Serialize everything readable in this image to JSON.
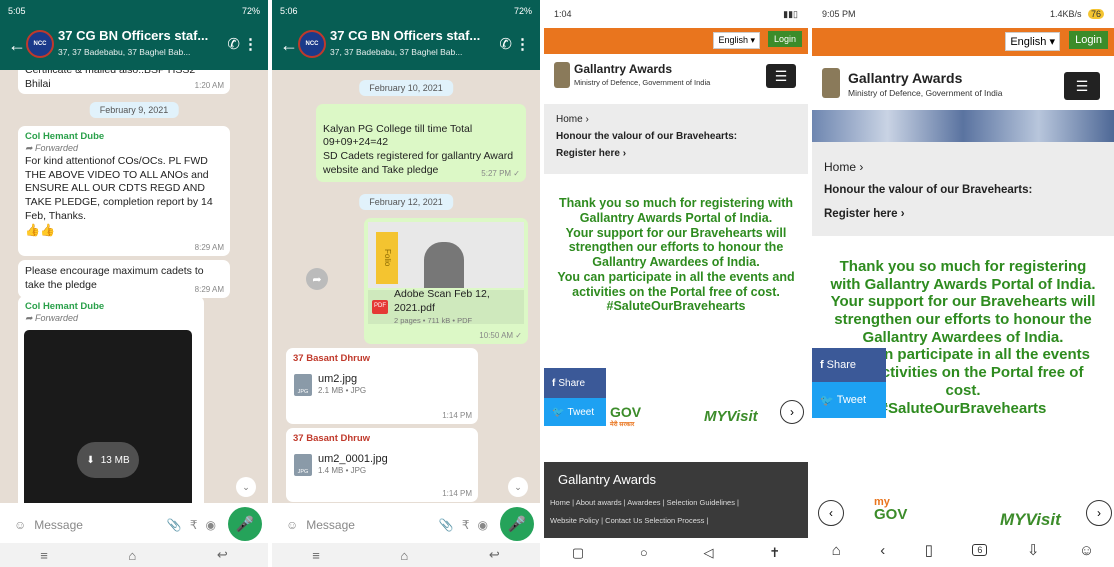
{
  "wa1": {
    "status_time": "5:05",
    "status_battery": "72%",
    "title": "37 CG BN Officers staf...",
    "subtitle": "37, 37 Badebabu, 37 Baghel Bab...",
    "top_text": "Certificate & mailed also..BSP HSS2 Bhilai",
    "top_time": "1:20 AM",
    "date": "February 9, 2021",
    "msg1": {
      "sender": "Col Hemant Dube",
      "fwd": "Forwarded",
      "text": "For kind attentionof COs/OCs.  PL FWD THE ABOVE VIDEO TO ALL ANOs and  ENSURE ALL OUR CDTS REGD AND TAKE PLEDGE, completion report by 14 Feb, Thanks.",
      "emoji": "👍👍",
      "time": "8:29 AM"
    },
    "msg2": {
      "text": "Please encourage maximum cadets to take the pledge",
      "time": "8:29 AM"
    },
    "msg3": {
      "sender": "Col Hemant Dube",
      "fwd": "Forwarded",
      "video_size": "13 MB"
    },
    "input_placeholder": "Message"
  },
  "wa2": {
    "status_time": "5:06",
    "status_battery": "72%",
    "title": "37 CG BN Officers staf...",
    "subtitle": "37, 37 Badebabu, 37 Baghel Bab...",
    "date1": "February 10, 2021",
    "out1": {
      "text": "Kalyan PG College till time Total\n 09+09+24=42\nSD Cadets registered for gallantry Award website and Take pledge",
      "time": "5:27 PM ✓"
    },
    "date2": "February 12, 2021",
    "pdf": {
      "name": "Adobe Scan Feb 12, 2021.pdf",
      "meta": "2 pages • 711 kB • PDF",
      "time": "10:50 AM ✓",
      "preview_text": "Folio"
    },
    "file1": {
      "sender": "37 Basant Dhruw",
      "name": "um2.jpg",
      "meta": "2.1 MB • JPG",
      "time": "1:14 PM"
    },
    "file2": {
      "sender": "37 Basant Dhruw",
      "name": "um2_0001.jpg",
      "meta": "1.4 MB • JPG",
      "time": "1:14 PM"
    },
    "input_placeholder": "Message"
  },
  "g1": {
    "status_time": "1:04",
    "lang": "English ▾",
    "login": "Login",
    "brand": "Gallantry Awards",
    "ministry": "Ministry of Defence, Government of India",
    "crumb_home": "Home  ›",
    "crumb_honour": "Honour the valour of our Bravehearts:",
    "crumb_register": "Register here  ›",
    "thanks": "Thank you so much for registering with Gallantry Awards Portal of India.\nYour support for our Bravehearts will strengthen our efforts to honour the Gallantry Awardees of India.\nYou can participate in all the events and activities on the Portal free of cost.\n#SaluteOurBravehearts",
    "share": "Share",
    "tweet": "Tweet",
    "mygov": "GOV",
    "mygov_sub": "मेरी सरकार",
    "myvisit": "MYVisit",
    "footer_title": "Gallantry Awards",
    "footer_links1": "Home  |  About awards  |  Awardees  |  Selection Guidelines  |",
    "footer_links2": "Website Policy  |  Contact Us    Selection Process  |"
  },
  "g2": {
    "status_time": "9:05 PM",
    "status_right": "1.4KB/s",
    "battery": "76",
    "lang": "English ▾",
    "login": "Login",
    "brand": "Gallantry Awards",
    "ministry": "Ministry of Defence, Government of India",
    "crumb_home": "Home  ›",
    "crumb_honour": "Honour the valour of our Bravehearts:",
    "crumb_register": "Register here  ›",
    "thanks": "Thank you so much for registering with Gallantry Awards Portal of India.\nYour support for our Bravehearts will strengthen our efforts to honour the Gallantry Awardees of India.\nYou can participate in all the events and activities on the Portal free of cost.\n#SaluteOurBravehearts",
    "share": "Share",
    "tweet": "Tweet",
    "mygov_my": "my",
    "mygov": "GOV",
    "myvisit": "MYVisit",
    "tab_count": "6"
  }
}
